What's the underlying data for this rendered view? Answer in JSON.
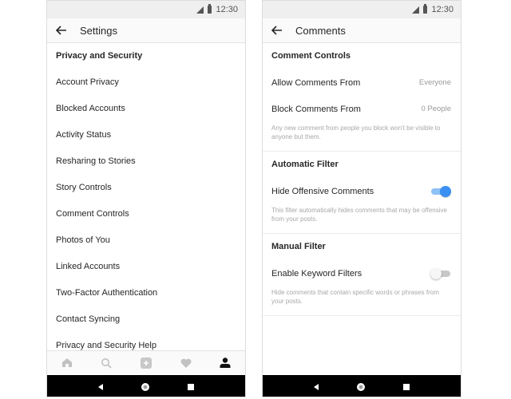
{
  "status_bar": {
    "time": "12:30"
  },
  "settings_screen": {
    "title": "Settings",
    "section_header": "Privacy and Security",
    "items": [
      {
        "label": "Account Privacy"
      },
      {
        "label": "Blocked Accounts"
      },
      {
        "label": "Activity Status"
      },
      {
        "label": "Resharing to Stories"
      },
      {
        "label": "Story Controls"
      },
      {
        "label": "Comment Controls"
      },
      {
        "label": "Photos of You"
      },
      {
        "label": "Linked Accounts"
      },
      {
        "label": "Two-Factor Authentication"
      },
      {
        "label": "Contact Syncing"
      },
      {
        "label": "Privacy and Security Help"
      }
    ],
    "tab_bar": [
      {
        "icon": "home-icon",
        "active": false
      },
      {
        "icon": "search-icon",
        "active": false
      },
      {
        "icon": "add-post-icon",
        "active": false
      },
      {
        "icon": "heart-icon",
        "active": false
      },
      {
        "icon": "profile-icon",
        "active": true
      }
    ]
  },
  "comments_screen": {
    "title": "Comments",
    "comment_controls": {
      "header": "Comment Controls",
      "allow_label": "Allow Comments From",
      "allow_value": "Everyone",
      "block_label": "Block Comments From",
      "block_value": "0 People",
      "note": "Any new comment from people you block won't be visible to anyone but them."
    },
    "automatic_filter": {
      "header": "Automatic Filter",
      "toggle_label": "Hide Offensive Comments",
      "enabled": true,
      "note": "This filter automatically hides comments that may be offensive from your posts."
    },
    "manual_filter": {
      "header": "Manual Filter",
      "toggle_label": "Enable Keyword Filters",
      "enabled": false,
      "note": "Hide comments that contain specific words or phrases from your posts."
    }
  },
  "colors": {
    "toggle_on": "#3a8ff0",
    "toggle_on_track": "#8ec1f6",
    "muted_text": "#9a9a9a"
  }
}
